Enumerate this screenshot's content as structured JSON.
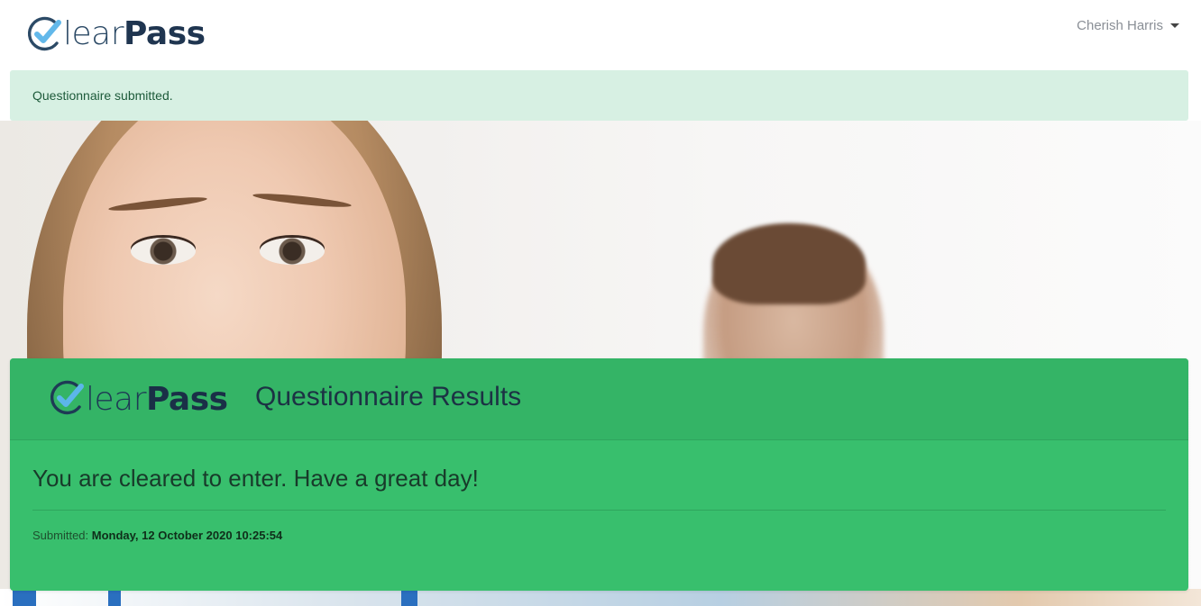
{
  "navbar": {
    "logo": {
      "part_light": "lear",
      "part_bold": "Pass"
    },
    "user_name": "Cherish Harris"
  },
  "alert": {
    "message": "Questionnaire submitted."
  },
  "card": {
    "logo": {
      "part_light": "lear",
      "part_bold": "Pass"
    },
    "title": "Questionnaire Results",
    "result_message": "You are cleared to enter. Have a great day!",
    "submitted_label": "Submitted:",
    "submitted_value": "Monday, 12 October 2020 10:25:54"
  },
  "colors": {
    "alert_background": "#d7f0e3",
    "card_background": "#38bf6d",
    "logo_navy": "#1f3550"
  },
  "icons": [
    "check-c-icon",
    "caret-down-icon"
  ]
}
